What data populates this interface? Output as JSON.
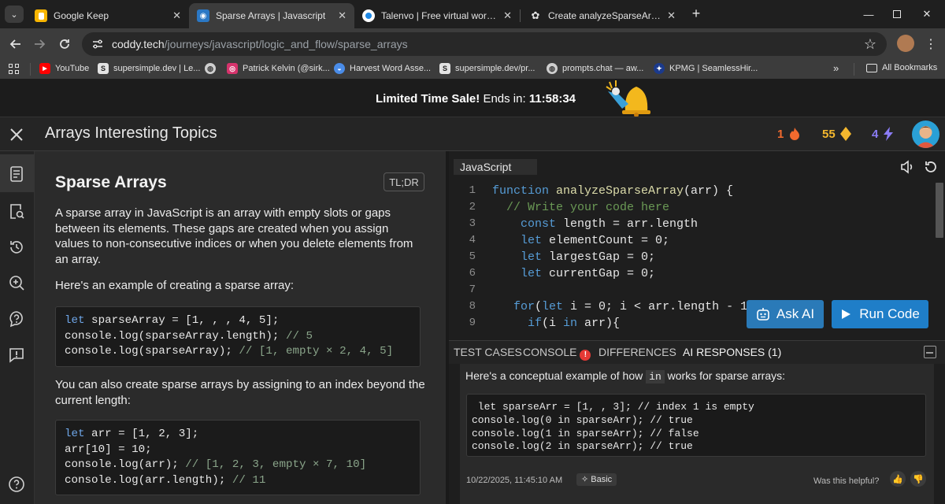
{
  "browser": {
    "tabs": [
      {
        "title": "Google Keep",
        "icon": "google-keep-icon"
      },
      {
        "title": "Sparse Arrays | Javascript",
        "icon": "coddy-icon"
      },
      {
        "title": "Talenvo | Free virtual work exper",
        "icon": "talenvo-icon"
      },
      {
        "title": "Create analyzeSparseArray func",
        "icon": "chatgpt-icon"
      }
    ],
    "url_host": "coddy.tech",
    "url_path": "/journeys/javascript/logic_and_flow/sparse_arrays",
    "bookmarks": [
      "YouTube",
      "supersimple.dev | Le...",
      "Patrick Kelvin (@sirk...",
      "Harvest Word Asse...",
      "supersimple.dev/pr...",
      "prompts.chat — aw...",
      "KPMG | SeamlessHir...",
      "All Bookmarks"
    ]
  },
  "sale": {
    "label": "Limited Time Sale!",
    "ends": "Ends in:",
    "timer": "11:58:34"
  },
  "header": {
    "title": "Arrays Interesting Topics",
    "streak": "1",
    "gems": "55",
    "energy": "4",
    "colors": {
      "streak": "#f26a2e",
      "gems": "#f5b82e",
      "energy": "#8b7cf6"
    }
  },
  "lesson": {
    "title": "Sparse Arrays",
    "tldr": "TL;DR",
    "p1": "A sparse array in JavaScript is an array with empty slots or gaps between its elements. These gaps are created when you assign values to non-consecutive indices or when you delete elements from an array.",
    "p2": "Here's an example of creating a sparse array:",
    "code1": [
      {
        "kw": "let",
        "rest": " sparseArray = [1, , , 4, 5];",
        "cm": ""
      },
      {
        "kw": "",
        "rest": "console.log(sparseArray.length); ",
        "cm": "// 5"
      },
      {
        "kw": "",
        "rest": "console.log(sparseArray); ",
        "cm": "// [1, empty × 2, 4, 5]"
      }
    ],
    "p3": "You can also create sparse arrays by assigning to an index beyond the current length:",
    "code2": [
      {
        "kw": "let",
        "rest": " arr = [1, 2, 3];",
        "cm": ""
      },
      {
        "kw": "",
        "rest": "arr[10] = 10;",
        "cm": ""
      },
      {
        "kw": "",
        "rest": "console.log(arr); ",
        "cm": "// [1, 2, 3, empty × 7, 10]"
      },
      {
        "kw": "",
        "rest": "console.log(arr.length); ",
        "cm": "// 11"
      }
    ]
  },
  "editor": {
    "language": "JavaScript",
    "line_numbers": [
      "1",
      "2",
      "3",
      "4",
      "5",
      "6",
      "7",
      "8",
      "9"
    ],
    "lines": [
      [
        {
          "t": "function ",
          "c": "ek"
        },
        {
          "t": "analyzeSparseArray",
          "c": "ef"
        },
        {
          "t": "(arr) {",
          "c": ""
        }
      ],
      [
        {
          "t": "  // Write your code here",
          "c": "ec"
        }
      ],
      [
        {
          "t": "    const ",
          "c": "ek"
        },
        {
          "t": "length = arr.length",
          "c": ""
        }
      ],
      [
        {
          "t": "    let ",
          "c": "ek"
        },
        {
          "t": "elementCount = 0;",
          "c": ""
        }
      ],
      [
        {
          "t": "    let ",
          "c": "ek"
        },
        {
          "t": "largestGap = 0;",
          "c": ""
        }
      ],
      [
        {
          "t": "    let ",
          "c": "ek"
        },
        {
          "t": "currentGap = 0;",
          "c": ""
        }
      ],
      [
        {
          "t": "",
          "c": ""
        }
      ],
      [
        {
          "t": "   for",
          "c": "ek"
        },
        {
          "t": "(",
          "c": ""
        },
        {
          "t": "let ",
          "c": "ek"
        },
        {
          "t": "i = 0; i < arr.length - 1",
          "c": ""
        }
      ],
      [
        {
          "t": "     if",
          "c": "ek"
        },
        {
          "t": "(i ",
          "c": ""
        },
        {
          "t": "in",
          "c": "ek"
        },
        {
          "t": " arr){",
          "c": ""
        }
      ]
    ],
    "ask_ai": "Ask AI",
    "run_code": "Run Code"
  },
  "bottom_tabs": {
    "test_cases": "TEST CASES",
    "console": "CONSOLE",
    "console_badge": "!",
    "differences": "DIFFERENCES",
    "ai_responses": "AI RESPONSES (1)"
  },
  "ai_response": {
    "intro_before": "Here's a conceptual example of how ",
    "intro_code": "in",
    "intro_after": " works for sparse arrays:",
    "code": " let sparseArr = [1, , 3]; // index 1 is empty\nconsole.log(0 in sparseArr); // true\nconsole.log(1 in sparseArr); // false\nconsole.log(2 in sparseArr); // true",
    "timestamp": "10/22/2025, 11:45:10 AM",
    "mode": "Basic",
    "helpful": "Was this helpful?"
  }
}
